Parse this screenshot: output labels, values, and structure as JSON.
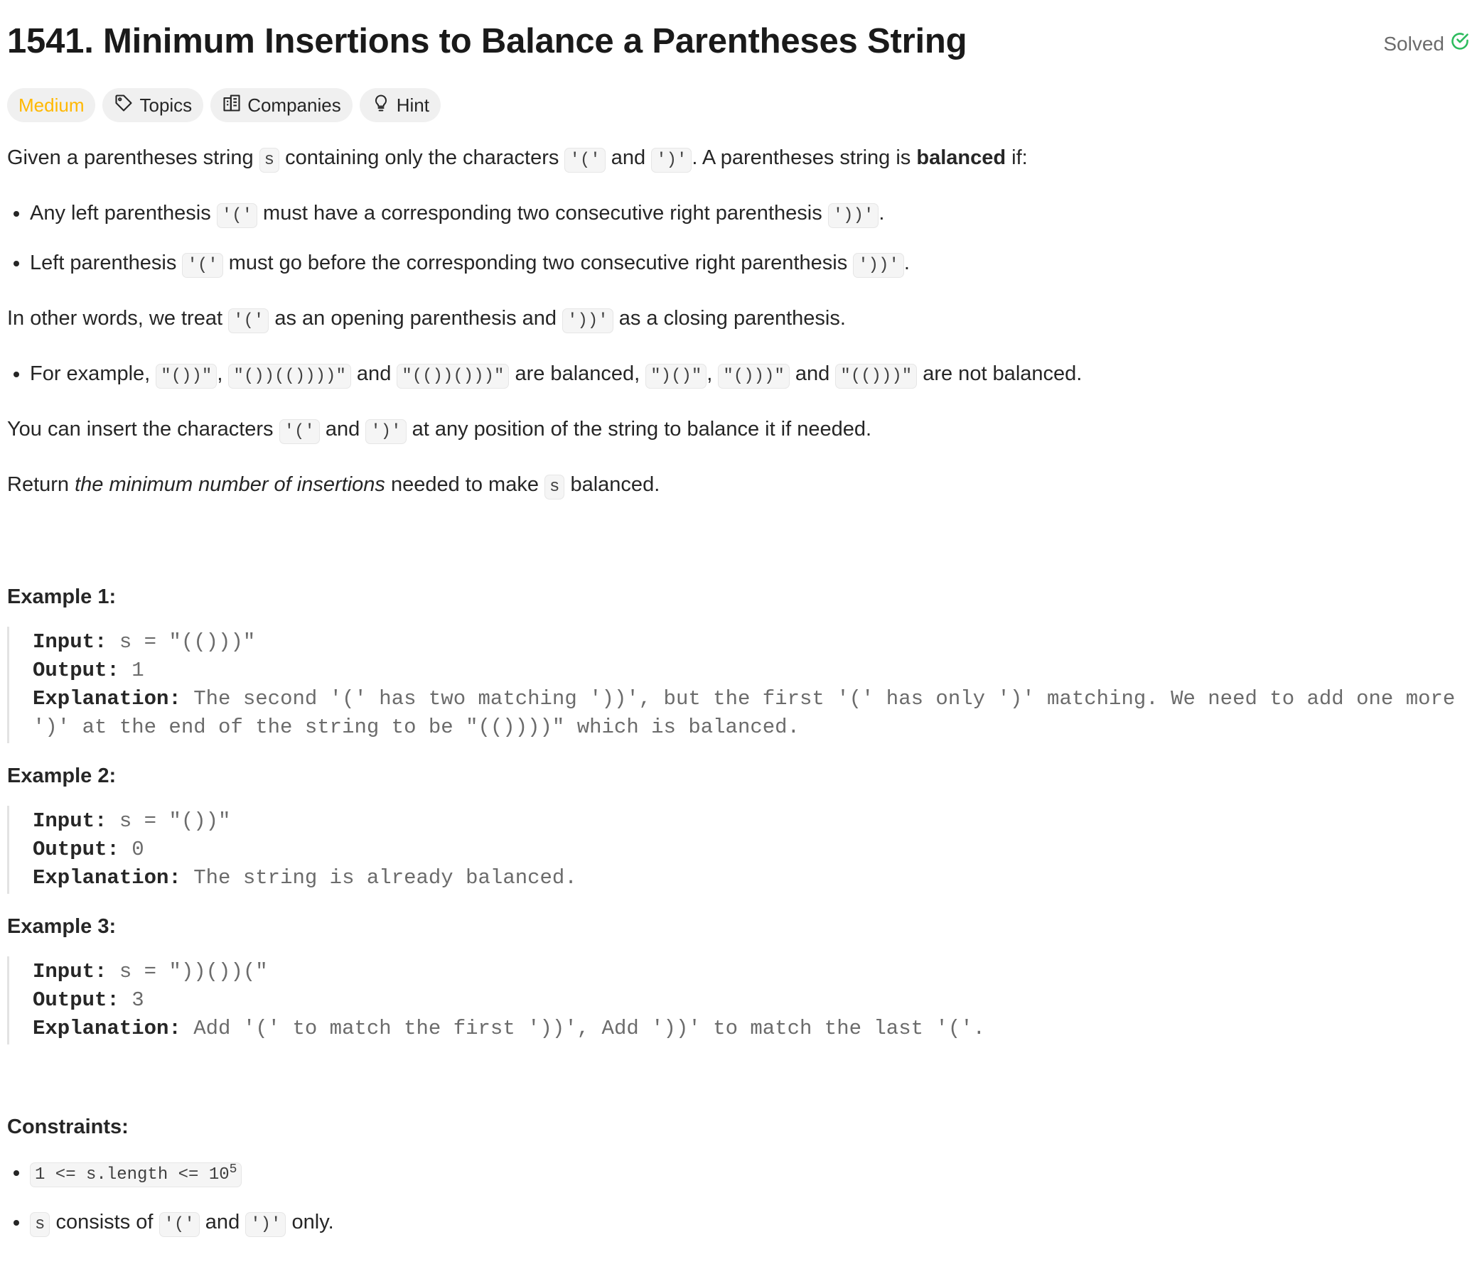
{
  "header": {
    "title": "1541. Minimum Insertions to Balance a Parentheses String",
    "solved_label": "Solved",
    "accent_green": "#2cbb5d"
  },
  "tags": {
    "difficulty": "Medium",
    "topics": "Topics",
    "companies": "Companies",
    "hint": "Hint",
    "difficulty_color": "#ffb800"
  },
  "description": {
    "p1": [
      "Given a parentheses string ",
      "s",
      " containing only the characters ",
      "'('",
      " and ",
      "')'",
      ". A parentheses string is ",
      "balanced",
      " if:"
    ],
    "bullets1": [
      [
        "Any left parenthesis ",
        "'('",
        " must have a corresponding two consecutive right parenthesis ",
        "'))'",
        "."
      ],
      [
        "Left parenthesis ",
        "'('",
        " must go before the corresponding two consecutive right parenthesis ",
        "'))'",
        "."
      ]
    ],
    "p2": [
      "In other words, we treat ",
      "'('",
      " as an opening parenthesis and ",
      "'))'",
      " as a closing parenthesis."
    ],
    "bullet2": [
      "For example, ",
      "\"())\"",
      ", ",
      "\"())(())))\"",
      " and ",
      "\"(())()))\"",
      " are balanced, ",
      "\")()\"",
      ", ",
      "\"()))\"",
      " and ",
      "\"(()))\"",
      " are not balanced."
    ],
    "p3": [
      "You can insert the characters ",
      "'('",
      " and ",
      "')'",
      " at any position of the string to balance it if needed."
    ],
    "p4": [
      "Return ",
      "the minimum number of insertions",
      " needed to make ",
      "s",
      " balanced."
    ]
  },
  "examples": [
    {
      "title": "Example 1:",
      "input_label": "Input:",
      "input": "s = \"(()))\"",
      "output_label": "Output:",
      "output": "1",
      "explanation_label": "Explanation:",
      "explanation": "The second '(' has two matching '))', but the first '(' has only ')' matching. We need to add one more ')' at the end of the string to be \"(())))\" which is balanced."
    },
    {
      "title": "Example 2:",
      "input_label": "Input:",
      "input": "s = \"())\"",
      "output_label": "Output:",
      "output": "0",
      "explanation_label": "Explanation:",
      "explanation": "The string is already balanced."
    },
    {
      "title": "Example 3:",
      "input_label": "Input:",
      "input": "s = \"))())(\"",
      "output_label": "Output:",
      "output": "3",
      "explanation_label": "Explanation:",
      "explanation": "Add '(' to match the first '))', Add '))' to match the last '('."
    }
  ],
  "constraints": {
    "title": "Constraints:",
    "c1_code": "1 <= s.length <= 10",
    "c1_exp": "5",
    "c2": [
      "s",
      " consists of ",
      "'('",
      " and ",
      "')'",
      " only."
    ]
  }
}
